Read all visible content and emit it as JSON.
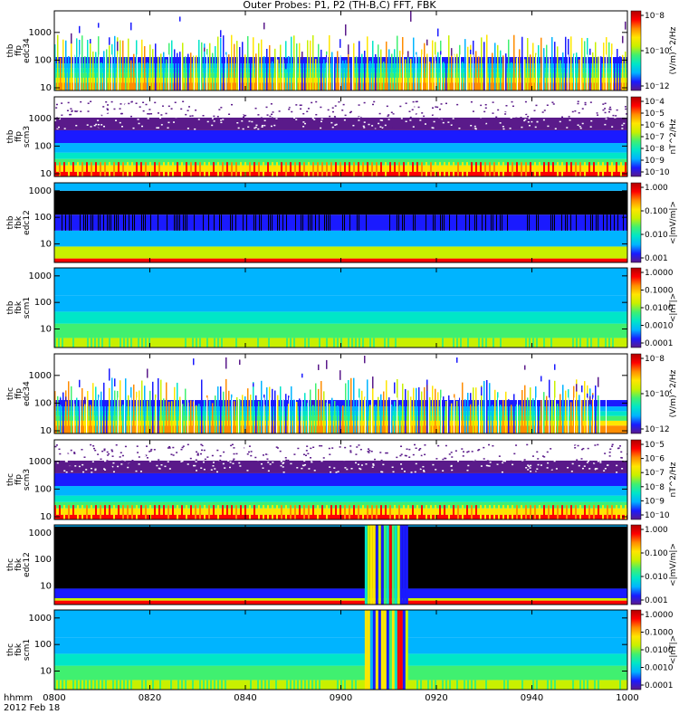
{
  "chart_data": {
    "type": "heatmap",
    "title": "Outer Probes: P1, P2 (TH-B,C) FFT, FBK",
    "x_ticks": [
      "0800",
      "0820",
      "0840",
      "0900",
      "0920",
      "0940",
      "1000"
    ],
    "x_range": [
      "0800",
      "1000"
    ],
    "x_time_label": "hhmm",
    "x_date_label": "2012 Feb 18",
    "panels": [
      {
        "probe": "thb",
        "instrument": "ffp",
        "channel": "edc34",
        "y_label_lines": [
          "thb",
          "ffp",
          "edc34"
        ],
        "y_scale": "log",
        "y_ticks": [
          "10",
          "100",
          "1000"
        ],
        "y_range": [
          8,
          6000
        ],
        "colorbar_label": "(V/m)^2/Hz",
        "colorbar_ticks": [
          "10^-8",
          "10^-10",
          "10^-12"
        ],
        "pattern": "spiky"
      },
      {
        "probe": "thb",
        "instrument": "ffp",
        "channel": "scm3",
        "y_label_lines": [
          "thb",
          "ffp",
          "scm3"
        ],
        "y_scale": "log",
        "y_ticks": [
          "10",
          "100",
          "1000"
        ],
        "y_range": [
          8,
          6000
        ],
        "colorbar_label": "nT^2/Hz",
        "colorbar_ticks": [
          "10^-4",
          "10^-5",
          "10^-6",
          "10^-7",
          "10^-8",
          "10^-9",
          "10^-10"
        ],
        "pattern": "layered"
      },
      {
        "probe": "thb",
        "instrument": "fbk",
        "channel": "edc12",
        "y_label_lines": [
          "thb",
          "fbk",
          "edc12"
        ],
        "y_scale": "log",
        "y_ticks": [
          "10",
          "100",
          "1000"
        ],
        "y_range": [
          2,
          2000
        ],
        "colorbar_label": "<|mV/m|>",
        "colorbar_ticks": [
          "1.000",
          "0.100",
          "0.010",
          "0.001"
        ],
        "pattern": "bands"
      },
      {
        "probe": "thb",
        "instrument": "fbk",
        "channel": "scm1",
        "y_label_lines": [
          "thb",
          "fbk",
          "scm1"
        ],
        "y_scale": "log",
        "y_ticks": [
          "10",
          "100",
          "1000"
        ],
        "y_range": [
          2,
          2000
        ],
        "colorbar_label": "<|nT|>",
        "colorbar_ticks": [
          "1.0000",
          "0.1000",
          "0.0100",
          "0.0010",
          "0.0001"
        ],
        "pattern": "smooth"
      },
      {
        "probe": "thc",
        "instrument": "ffp",
        "channel": "edc34",
        "y_label_lines": [
          "thc",
          "ffp",
          "edc34"
        ],
        "y_scale": "log",
        "y_ticks": [
          "10",
          "100",
          "1000"
        ],
        "y_range": [
          8,
          6000
        ],
        "colorbar_label": "(V/m)^2/Hz",
        "colorbar_ticks": [
          "10^-8",
          "10^-10",
          "10^-12"
        ],
        "pattern": "spiky"
      },
      {
        "probe": "thc",
        "instrument": "ffp",
        "channel": "scm3",
        "y_label_lines": [
          "thc",
          "ffp",
          "scm3"
        ],
        "y_scale": "log",
        "y_ticks": [
          "10",
          "100",
          "1000"
        ],
        "y_range": [
          8,
          6000
        ],
        "colorbar_label": "nT^2/Hz",
        "colorbar_ticks": [
          "10^-5",
          "10^-6",
          "10^-7",
          "10^-8",
          "10^-9",
          "10^-10"
        ],
        "pattern": "layered"
      },
      {
        "probe": "thc",
        "instrument": "fbk",
        "channel": "edc12",
        "y_label_lines": [
          "thc",
          "fbk",
          "edc12"
        ],
        "y_scale": "log",
        "y_ticks": [
          "10",
          "100",
          "1000"
        ],
        "y_range": [
          2,
          2000
        ],
        "colorbar_label": "<|mV/m|>",
        "colorbar_ticks": [
          "1.000",
          "0.100",
          "0.010",
          "0.001"
        ],
        "pattern": "event_dark"
      },
      {
        "probe": "thc",
        "instrument": "fbk",
        "channel": "scm1",
        "y_label_lines": [
          "thc",
          "fbk",
          "scm1"
        ],
        "y_scale": "log",
        "y_ticks": [
          "10",
          "100",
          "1000"
        ],
        "y_range": [
          2,
          2000
        ],
        "colorbar_label": "<|nT|>",
        "colorbar_ticks": [
          "1.0000",
          "0.1000",
          "0.0100",
          "0.0010",
          "0.0001"
        ],
        "pattern": "event_smooth"
      }
    ],
    "event_interval": [
      "0905",
      "0914"
    ],
    "colormap": [
      "#ffffff",
      "#5a1a8a",
      "#1a1aff",
      "#00b4ff",
      "#00e6c8",
      "#40f070",
      "#c8f000",
      "#ffe600",
      "#ff8c00",
      "#ff0000",
      "#b00000"
    ]
  }
}
